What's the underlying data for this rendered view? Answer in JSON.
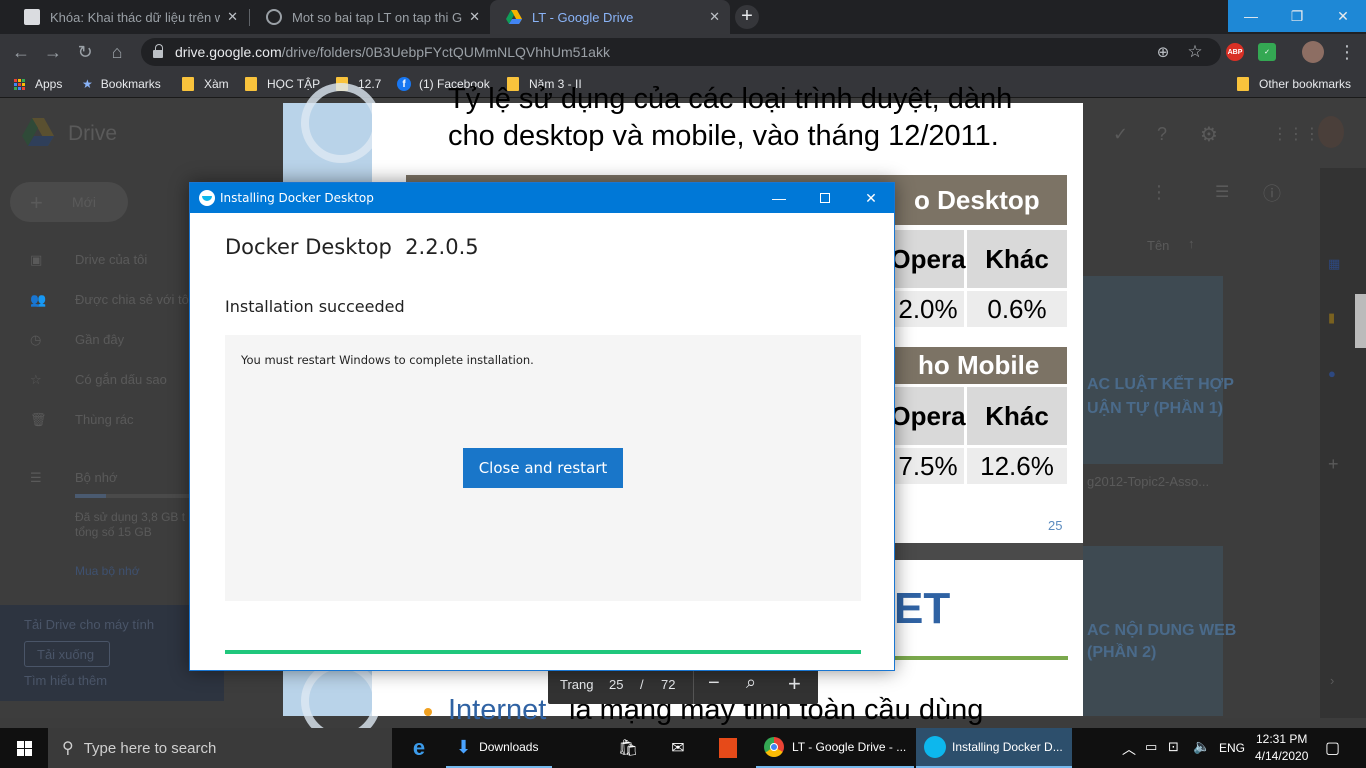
{
  "browser": {
    "tabs": [
      {
        "label": "Khóa: Khai thác dữ liệu trên web",
        "favicon": "page-icon",
        "active": false
      },
      {
        "label": "Mot so bai tap LT on tap thi GK.p",
        "favicon": "globe-icon",
        "active": false
      },
      {
        "label": "LT - Google Drive",
        "favicon": "google-drive-icon",
        "active": true
      }
    ],
    "new_tab_glyph": "+",
    "url_host": "drive.google.com",
    "url_path": "/drive/folders/0B3UebpFYctQUMmNLQVhhUm51akk",
    "bookmarks": [
      {
        "label": "Apps",
        "icon": "apps-grid-icon"
      },
      {
        "label": "Bookmarks",
        "icon": "star-icon"
      },
      {
        "label": "Xàm",
        "icon": "folder-icon"
      },
      {
        "label": "HỌC TẬP",
        "icon": "folder-icon"
      },
      {
        "label": "12.7",
        "icon": "folder-icon"
      },
      {
        "label": "(1) Facebook",
        "icon": "facebook-icon"
      },
      {
        "label": "Năm 3 - II",
        "icon": "folder-icon"
      }
    ],
    "other_bookmarks": "Other bookmarks",
    "extensions": {
      "abp": "ABP"
    }
  },
  "drive": {
    "app_name": "Drive",
    "new_button": "Mới",
    "nav": [
      "Drive của tôi",
      "Được chia sẻ với tôi",
      "Gần đây",
      "Có gắn dấu sao",
      "Thùng rác"
    ],
    "storage_label": "Bộ nhớ",
    "storage_usage_line1": "Đã sử dụng 3,8 GB t",
    "storage_usage_line2": "tổng số 15 GB",
    "buy_storage": "Mua bộ nhớ",
    "promo_title": "Tải Drive cho máy tính",
    "promo_download": "Tải xuống",
    "promo_learn": "Tìm hiểu thêm",
    "sort_label": "Tên",
    "thumb_caption": "g2012-Topic2-Asso..."
  },
  "pdf": {
    "line1": "Tỷ lệ sử dụng của các loại trình duyệt, dành",
    "line2": "cho desktop và mobile, vào tháng 12/2011.",
    "desktop_header": "o Desktop",
    "mobile_header": "ho Mobile",
    "col_opera": "Opera",
    "col_other": "Khác",
    "desktop_opera": "2.0%",
    "desktop_other": "0.6%",
    "mobile_opera": "7.5%",
    "mobile_other": "12.6%",
    "slide_number": "25",
    "slide2_title": "ET",
    "slide2_bullet_link": "Internet",
    "slide2_bullet_text": "là mạng máy tính toàn cầu dùng",
    "page_label": "Trang",
    "page_current": "25",
    "page_sep": "/",
    "page_total": "72"
  },
  "dialog": {
    "window_title": "Installing Docker Desktop",
    "heading": "Docker Desktop  2.2.0.5",
    "status": "Installation succeeded",
    "message": "You must restart Windows to complete installation.",
    "restart_button": "Close and restart",
    "progress": 1.0
  },
  "taskbar": {
    "search_placeholder": "Type here to search",
    "items": [
      {
        "label": "",
        "icon": "edge-icon"
      },
      {
        "label": "Downloads",
        "icon": "downloads-folder-icon"
      },
      {
        "label": "",
        "icon": "store-icon"
      },
      {
        "label": "",
        "icon": "mail-icon"
      },
      {
        "label": "",
        "icon": "office-icon"
      },
      {
        "label": "LT - Google Drive - ...",
        "icon": "chrome-icon"
      },
      {
        "label": "Installing Docker D...",
        "icon": "docker-icon"
      }
    ],
    "language": "ENG",
    "time": "12:31 PM",
    "date": "4/14/2020"
  },
  "colors": {
    "chrome_dark": "#202124",
    "titlebar_blue": "#0078d7",
    "docker_button": "#1976c9",
    "progress_green": "#20c77c",
    "table_header": "#7c7365"
  }
}
